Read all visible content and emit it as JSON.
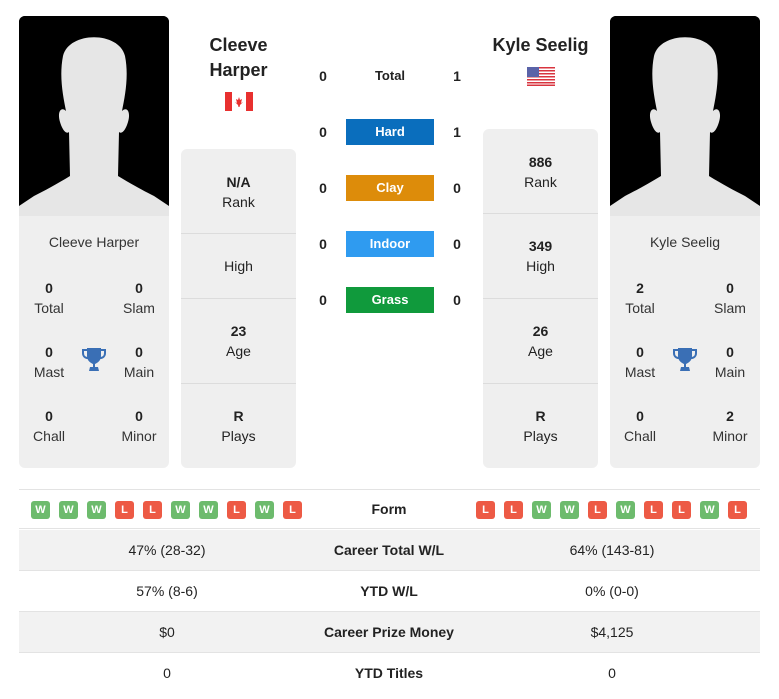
{
  "players": [
    {
      "name": "Cleeve Harper",
      "name_line1": "Cleeve",
      "name_line2": "Harper",
      "country_flag": "canada-flag",
      "photo": "silhouette-placeholder",
      "titles": {
        "total": {
          "value": "0",
          "label": "Total"
        },
        "slam": {
          "value": "0",
          "label": "Slam"
        },
        "mast": {
          "value": "0",
          "label": "Mast"
        },
        "main": {
          "value": "0",
          "label": "Main"
        },
        "chall": {
          "value": "0",
          "label": "Chall"
        },
        "minor": {
          "value": "0",
          "label": "Minor"
        }
      },
      "info": {
        "rank": {
          "value": "N/A",
          "label": "Rank"
        },
        "high": {
          "value": "",
          "label": "High"
        },
        "age": {
          "value": "23",
          "label": "Age"
        },
        "plays": {
          "value": "R",
          "label": "Plays"
        }
      },
      "form": [
        "W",
        "W",
        "W",
        "L",
        "L",
        "W",
        "W",
        "L",
        "W",
        "L"
      ]
    },
    {
      "name": "Kyle Seelig",
      "country_flag": "usa-flag",
      "photo": "silhouette-placeholder",
      "titles": {
        "total": {
          "value": "2",
          "label": "Total"
        },
        "slam": {
          "value": "0",
          "label": "Slam"
        },
        "mast": {
          "value": "0",
          "label": "Mast"
        },
        "main": {
          "value": "0",
          "label": "Main"
        },
        "chall": {
          "value": "0",
          "label": "Chall"
        },
        "minor": {
          "value": "2",
          "label": "Minor"
        }
      },
      "info": {
        "rank": {
          "value": "886",
          "label": "Rank"
        },
        "high": {
          "value": "349",
          "label": "High"
        },
        "age": {
          "value": "26",
          "label": "Age"
        },
        "plays": {
          "value": "R",
          "label": "Plays"
        }
      },
      "form": [
        "L",
        "L",
        "W",
        "W",
        "L",
        "W",
        "L",
        "L",
        "W",
        "L"
      ]
    }
  ],
  "h2h": [
    {
      "label": "Total",
      "left": "0",
      "right": "1",
      "color": ""
    },
    {
      "label": "Hard",
      "left": "0",
      "right": "1",
      "color": "#0a6ebd"
    },
    {
      "label": "Clay",
      "left": "0",
      "right": "0",
      "color": "#dd8c0a"
    },
    {
      "label": "Indoor",
      "left": "0",
      "right": "0",
      "color": "#2f9bf0"
    },
    {
      "label": "Grass",
      "left": "0",
      "right": "0",
      "color": "#109a3c"
    }
  ],
  "form_label": "Form",
  "stats": [
    {
      "label": "Career Total W/L",
      "left": "47% (28-32)",
      "right": "64% (143-81)"
    },
    {
      "label": "YTD W/L",
      "left": "57% (8-6)",
      "right": "0% (0-0)"
    },
    {
      "label": "Career Prize Money",
      "left": "$0",
      "right": "$4,125"
    },
    {
      "label": "YTD Titles",
      "left": "0",
      "right": "0"
    }
  ],
  "colors": {
    "win": "#6dbb6d",
    "loss": "#ed5a45",
    "trophy": "#3a6fb5"
  }
}
